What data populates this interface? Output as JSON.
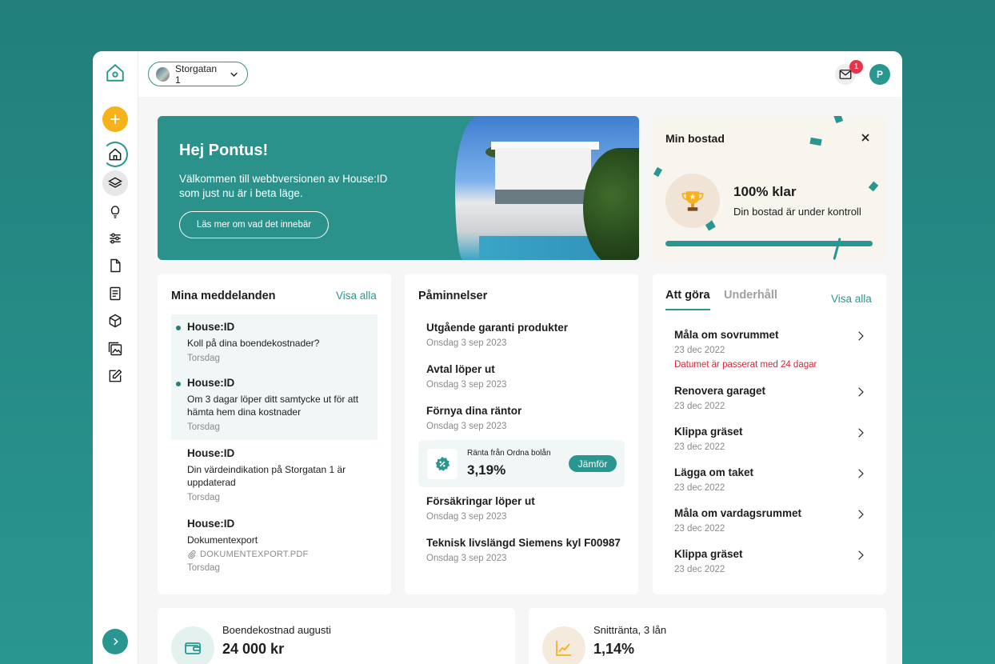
{
  "topbar": {
    "property_name": "Storgatan 1",
    "mail_badge": "1",
    "user_initial": "P"
  },
  "sidebar": {
    "icons": [
      "logo-home-icon",
      "add-icon",
      "home-icon",
      "layers-icon",
      "bulb-icon",
      "sliders-icon",
      "document-icon",
      "checklist-icon",
      "box-icon",
      "gallery-icon",
      "edit-icon",
      "chevron-right-icon"
    ]
  },
  "hero": {
    "title": "Hej Pontus!",
    "text": "Välkommen till webbversionen av House:ID som just nu är i beta läge.",
    "button": "Läs mer om vad det innebär"
  },
  "bostad": {
    "title": "Min bostad",
    "percent": "100% klar",
    "subtitle": "Din bostad är under kontroll",
    "progress": 1.0
  },
  "messages": {
    "title": "Mina meddelanden",
    "link": "Visa alla",
    "items": [
      {
        "sender": "House:ID",
        "body": "Koll på dina boendekostnader?",
        "date": "Torsdag",
        "unread": true
      },
      {
        "sender": "House:ID",
        "body": "Om 3 dagar löper ditt samtycke ut för att hämta hem dina kostnader",
        "date": "Torsdag",
        "unread": true
      },
      {
        "sender": "House:ID",
        "body": "Din värdeindikation på Storgatan 1 är uppdaterad",
        "date": "Torsdag",
        "unread": false
      },
      {
        "sender": "House:ID",
        "body": "Dokumentexport",
        "file": "DOKUMENTEXPORT.PDF",
        "date": "Torsdag",
        "unread": false
      }
    ]
  },
  "reminders": {
    "title": "Påminnelser",
    "items": [
      {
        "title": "Utgående garanti produkter",
        "date": "Onsdag 3 sep 2023"
      },
      {
        "title": "Avtal löper ut",
        "date": "Onsdag 3 sep 2023"
      },
      {
        "title": "Förnya dina räntor",
        "date": "Onsdag 3 sep 2023"
      },
      {
        "title": "Försäkringar löper ut",
        "date": "Onsdag 3 sep 2023"
      },
      {
        "title": "Teknisk livslängd Siemens kyl F00987",
        "date": "Onsdag 3 sep 2023"
      }
    ],
    "rate": {
      "label": "Ränta från Ordna bolån",
      "value": "3,19%",
      "button": "Jämför"
    }
  },
  "todo": {
    "tab_active": "Att göra",
    "tab_inactive": "Underhåll",
    "link": "Visa alla",
    "items": [
      {
        "title": "Måla om sovrummet",
        "date": "23 dec 2022",
        "warning": "Datumet är passerat med 24 dagar"
      },
      {
        "title": "Renovera garaget",
        "date": "23 dec 2022"
      },
      {
        "title": "Klippa gräset",
        "date": "23 dec 2022"
      },
      {
        "title": "Lägga om taket",
        "date": "23 dec 2022"
      },
      {
        "title": "Måla om vardagsrummet",
        "date": "23 dec 2022"
      },
      {
        "title": "Klippa gräset",
        "date": "23 dec 2022"
      }
    ]
  },
  "stats": [
    {
      "label": "Boendekostnad augusti",
      "value": "24 000 kr",
      "icon": "wallet-icon"
    },
    {
      "label": "Snittränta, 3 lån",
      "value": "1,14%",
      "icon": "chart-icon"
    }
  ],
  "colors": {
    "accent": "#2a9690",
    "yellow": "#f6b21a",
    "warning": "#d8263a",
    "background": "#227f7b"
  }
}
